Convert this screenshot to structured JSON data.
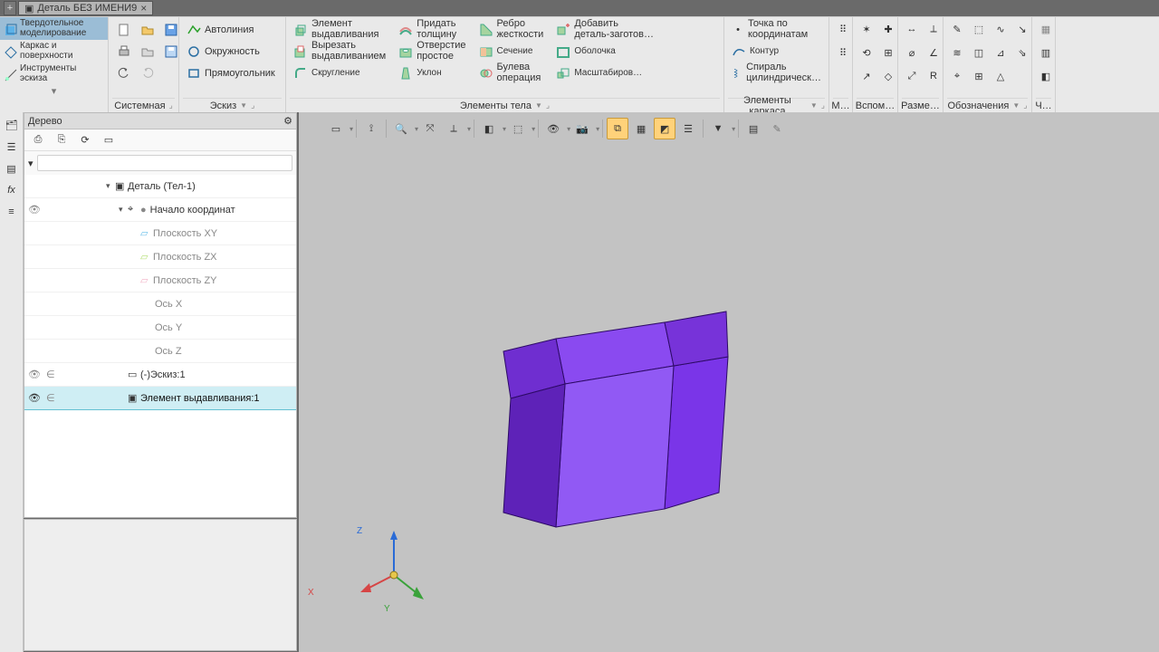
{
  "tab": {
    "title": "Деталь БЕЗ ИМЕНИ9"
  },
  "modes": {
    "solid": "Твердотельное\nмоделирование",
    "wire": "Каркас и\nповерхности",
    "sketchtools": "Инструменты\nэскиза"
  },
  "groups": {
    "system": "Системная",
    "sketch": "Эскиз",
    "body": "Элементы тела",
    "frame": "Элементы каркаса",
    "m": "М…",
    "aux": "Вспом…",
    "dims": "Разме…",
    "notes": "Обозначения",
    "ch": "Ч…"
  },
  "sketch_cmds": {
    "autoline": "Автолиния",
    "circle": "Окружность",
    "rect": "Прямоугольник"
  },
  "body_cmds": {
    "extrude1": "Элемент",
    "extrude2": "выдавливания",
    "cut1": "Вырезать",
    "cut2": "выдавливанием",
    "fillet": "Скругление",
    "thick1": "Придать",
    "thick2": "толщину",
    "hole1": "Отверстие",
    "hole2": "простое",
    "draft": "Уклон",
    "rib1": "Ребро",
    "rib2": "жесткости",
    "section": "Сечение",
    "bool1": "Булева",
    "bool2": "операция",
    "add1": "Добавить",
    "add2": "деталь-заготов…",
    "shell": "Оболочка",
    "scale": "Масштабиров…"
  },
  "frame_cmds": {
    "pt1": "Точка по",
    "pt2": "координатам",
    "contour": "Контур",
    "helix1": "Спираль",
    "helix2": "цилиндрическ…"
  },
  "treepanel": {
    "title": "Дерево",
    "search_placeholder": "",
    "root": "Деталь (Тел-1)",
    "origin": "Начало координат",
    "planeXY": "Плоскость XY",
    "planeZX": "Плоскость ZX",
    "planeZY": "Плоскость ZY",
    "axisX": "Ось X",
    "axisY": "Ось Y",
    "axisZ": "Ось Z",
    "sketch": "(-)Эскиз:1",
    "extr": "Элемент выдавливания:1"
  },
  "axes": {
    "x": "X",
    "y": "Y",
    "z": "Z"
  }
}
